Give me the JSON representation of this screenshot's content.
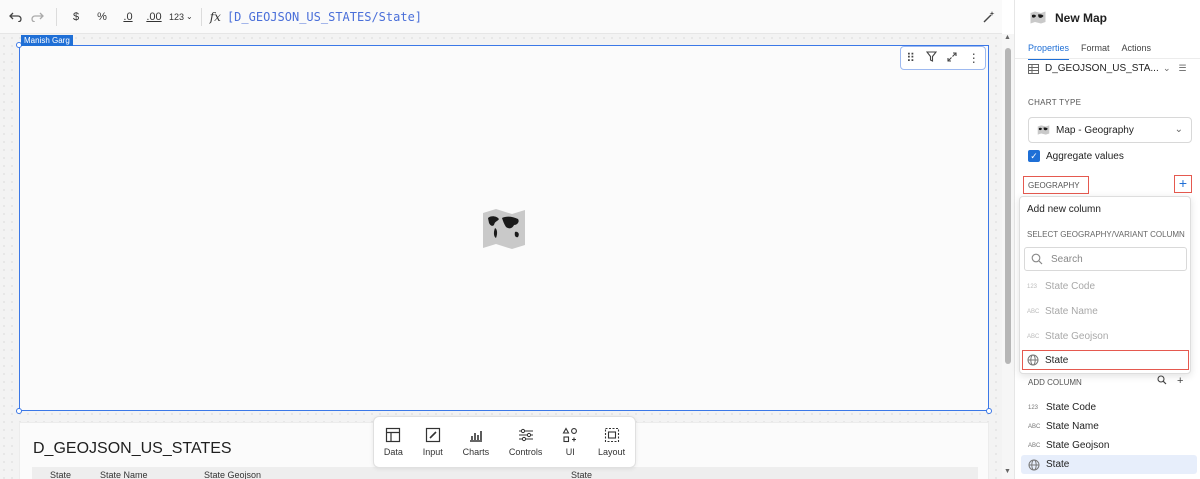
{
  "toolbar": {
    "undo": "⮌",
    "redo": "⮎",
    "currency": "$",
    "percent": "%",
    "decrease_decimals": ".0",
    "increase_decimals": ".00",
    "number_format": "123",
    "fx": "fx",
    "formula": "[D_GEOJSON_US_STATES/State]"
  },
  "canvas": {
    "owner_tag": "Manish Garg",
    "table_title": "D_GEOJSON_US_STATES",
    "table_headers": [
      "State Code",
      "State Name",
      "State Geojson",
      "State"
    ]
  },
  "bottom_bar": {
    "items": [
      "Data",
      "Input",
      "Charts",
      "Controls",
      "UI",
      "Layout"
    ]
  },
  "panel": {
    "title": "New Map",
    "tabs": [
      "Properties",
      "Format",
      "Actions"
    ],
    "source": "D_GEOJSON_US_STA...",
    "chart_type_label": "CHART TYPE",
    "chart_type_value": "Map - Geography",
    "aggregate_label": "Aggregate values",
    "aggregate_checked": true,
    "geography_label": "GEOGRAPHY",
    "add_button": "+",
    "dropdown": {
      "add_new": "Add new column",
      "section": "SELECT GEOGRAPHY/VARIANT COLUMN",
      "search_placeholder": "Search",
      "items": [
        {
          "type": "123",
          "label": "State Code"
        },
        {
          "type": "ABC",
          "label": "State Name"
        },
        {
          "type": "ABC",
          "label": "State Geojson"
        },
        {
          "type": "globe",
          "label": "State"
        }
      ]
    },
    "add_column_label": "ADD COLUMN",
    "columns": [
      {
        "type": "123",
        "label": "State Code"
      },
      {
        "type": "ABC",
        "label": "State Name"
      },
      {
        "type": "ABC",
        "label": "State Geojson"
      },
      {
        "type": "globe",
        "label": "State"
      }
    ]
  },
  "colors": {
    "accent": "#1f6fd6",
    "highlight_border": "#e5594f"
  }
}
